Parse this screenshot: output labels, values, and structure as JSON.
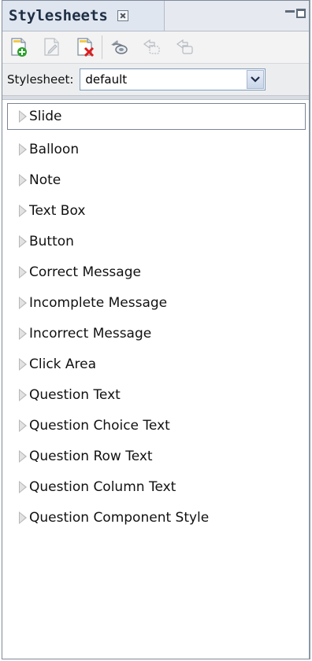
{
  "panel": {
    "title": "Stylesheets"
  },
  "toolbar": {
    "buttons": [
      {
        "icon": "new-stylesheet-icon"
      },
      {
        "icon": "edit-stylesheet-icon"
      },
      {
        "icon": "delete-stylesheet-icon"
      },
      {
        "icon": "apply-style-icon"
      },
      {
        "icon": "import-style-icon"
      },
      {
        "icon": "export-style-icon"
      }
    ]
  },
  "selector": {
    "label": "Stylesheet:",
    "value": "default"
  },
  "styles": [
    {
      "label": "Slide"
    },
    {
      "label": "Balloon"
    },
    {
      "label": "Note"
    },
    {
      "label": "Text Box"
    },
    {
      "label": "Button"
    },
    {
      "label": "Correct Message"
    },
    {
      "label": "Incomplete Message"
    },
    {
      "label": "Incorrect Message"
    },
    {
      "label": "Click Area"
    },
    {
      "label": "Question Text"
    },
    {
      "label": "Question Choice Text"
    },
    {
      "label": "Question Row Text"
    },
    {
      "label": "Question Column Text"
    },
    {
      "label": "Question Component Style"
    }
  ],
  "colors": {
    "accent": "#e01b1b",
    "new_green": "#2aa12a",
    "selection_border": "#7a8594"
  }
}
